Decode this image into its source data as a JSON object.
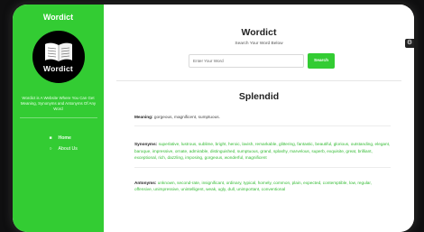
{
  "sidebar": {
    "brand": "Wordict",
    "logo_text": "Wordict",
    "tagline": "Wordict is A Website Where You Can Get Meaning, Synonyms and Antonyms Of Any Word",
    "nav": [
      {
        "label": "Home",
        "icon": "home-icon"
      },
      {
        "label": "About Us",
        "icon": "info-icon"
      }
    ]
  },
  "header": {
    "title": "Wordict",
    "subtitle": "Search Your Word Below"
  },
  "search": {
    "placeholder": "Enter Your Word",
    "button": "Search"
  },
  "result": {
    "word": "Splendid",
    "meaning_label": "Meaning:",
    "meaning": "gorgeous, magnificent, sumptuous.",
    "synonyms_label": "Synonyms:",
    "synonyms": "superlative, lustrous, sublime, bright, heroic, lavish, remarkable, glittering, fantastic, beautiful, glorious, outstanding, elegant, baroque, impressive, ornate, admirable, distinguished, sumptuous, grand, splashy, marvelous, superb, exquisite, great, brilliant, exceptional, rich, dazzling, imposing, gorgeous, wonderful, magnificent",
    "antonyms_label": "Antonyms:",
    "antonyms": "unknown, second-rate, insignificant, ordinary, typical, homely, common, plain, expected, contemptible, low, regular, offensive, unimpressive, unintelligent, weak, ugly, dull, unimportant, conventional"
  },
  "colors": {
    "accent": "#33cc33"
  }
}
